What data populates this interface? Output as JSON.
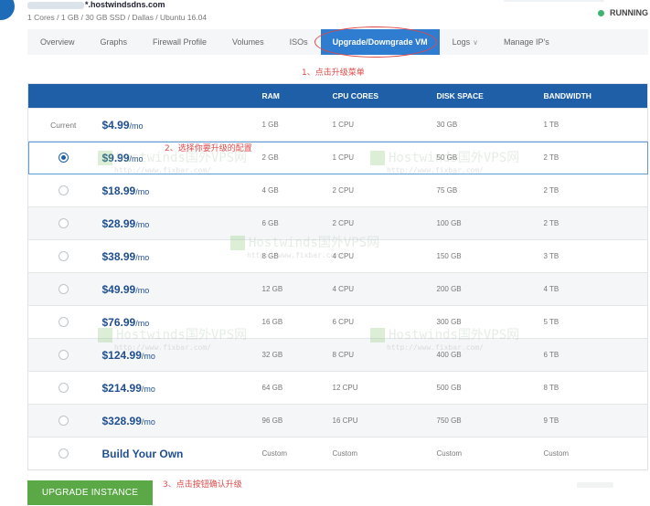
{
  "header": {
    "hostname": "*.hostwindsdns.com",
    "specs": "1 Cores / 1 GB / 30 GB SSD / Dallas / Ubuntu 16.04",
    "status": "RUNNING",
    "status_color": "#3cb371"
  },
  "tabs": [
    {
      "label": "Overview"
    },
    {
      "label": "Graphs"
    },
    {
      "label": "Firewall Profile"
    },
    {
      "label": "Volumes"
    },
    {
      "label": "ISOs"
    },
    {
      "label": "Upgrade/Downgrade VM",
      "active": true
    },
    {
      "label": "Logs",
      "icon": "chevron-down-icon"
    },
    {
      "label": "Manage IP's"
    }
  ],
  "annotations": {
    "step1": "1、点击升级菜单",
    "step2": "2、选择你要升级的配置",
    "step3": "3、点击按钮确认升级"
  },
  "table": {
    "headers": [
      "",
      "",
      "RAM",
      "CPU CORES",
      "DISK SPACE",
      "BANDWIDTH"
    ],
    "current_label": "Current",
    "rows": [
      {
        "price": "$4.99",
        "per": "/mo",
        "ram": "1 GB",
        "cpu": "1 CPU",
        "disk": "30 GB",
        "bw": "1 TB",
        "current": true
      },
      {
        "price": "$9.99",
        "per": "/mo",
        "ram": "2 GB",
        "cpu": "1 CPU",
        "disk": "50 GB",
        "bw": "2 TB",
        "selected": true
      },
      {
        "price": "$18.99",
        "per": "/mo",
        "ram": "4 GB",
        "cpu": "2 CPU",
        "disk": "75 GB",
        "bw": "2 TB"
      },
      {
        "price": "$28.99",
        "per": "/mo",
        "ram": "6 GB",
        "cpu": "2 CPU",
        "disk": "100 GB",
        "bw": "2 TB"
      },
      {
        "price": "$38.99",
        "per": "/mo",
        "ram": "8 GB",
        "cpu": "4 CPU",
        "disk": "150 GB",
        "bw": "3 TB"
      },
      {
        "price": "$49.99",
        "per": "/mo",
        "ram": "12 GB",
        "cpu": "4 CPU",
        "disk": "200 GB",
        "bw": "4 TB"
      },
      {
        "price": "$76.99",
        "per": "/mo",
        "ram": "16 GB",
        "cpu": "6 CPU",
        "disk": "300 GB",
        "bw": "5 TB"
      },
      {
        "price": "$124.99",
        "per": "/mo",
        "ram": "32 GB",
        "cpu": "8 CPU",
        "disk": "400 GB",
        "bw": "6 TB"
      },
      {
        "price": "$214.99",
        "per": "/mo",
        "ram": "64 GB",
        "cpu": "12 CPU",
        "disk": "500 GB",
        "bw": "8 TB"
      },
      {
        "price": "$328.99",
        "per": "/mo",
        "ram": "96 GB",
        "cpu": "16 CPU",
        "disk": "750 GB",
        "bw": "9 TB"
      }
    ],
    "custom_row": {
      "label": "Build Your Own",
      "ram": "Custom",
      "cpu": "Custom",
      "disk": "Custom",
      "bw": "Custom"
    }
  },
  "watermark": {
    "brand": "Hostwinds国外VPS网",
    "url": "http://www.fixbar.com/"
  },
  "upgrade_button": "UPGRADE INSTANCE",
  "colors": {
    "accent": "#2f7dd0",
    "header": "#1f5fa8",
    "price": "#1f4f8f",
    "button": "#5aa846",
    "annotation": "#e04848"
  }
}
